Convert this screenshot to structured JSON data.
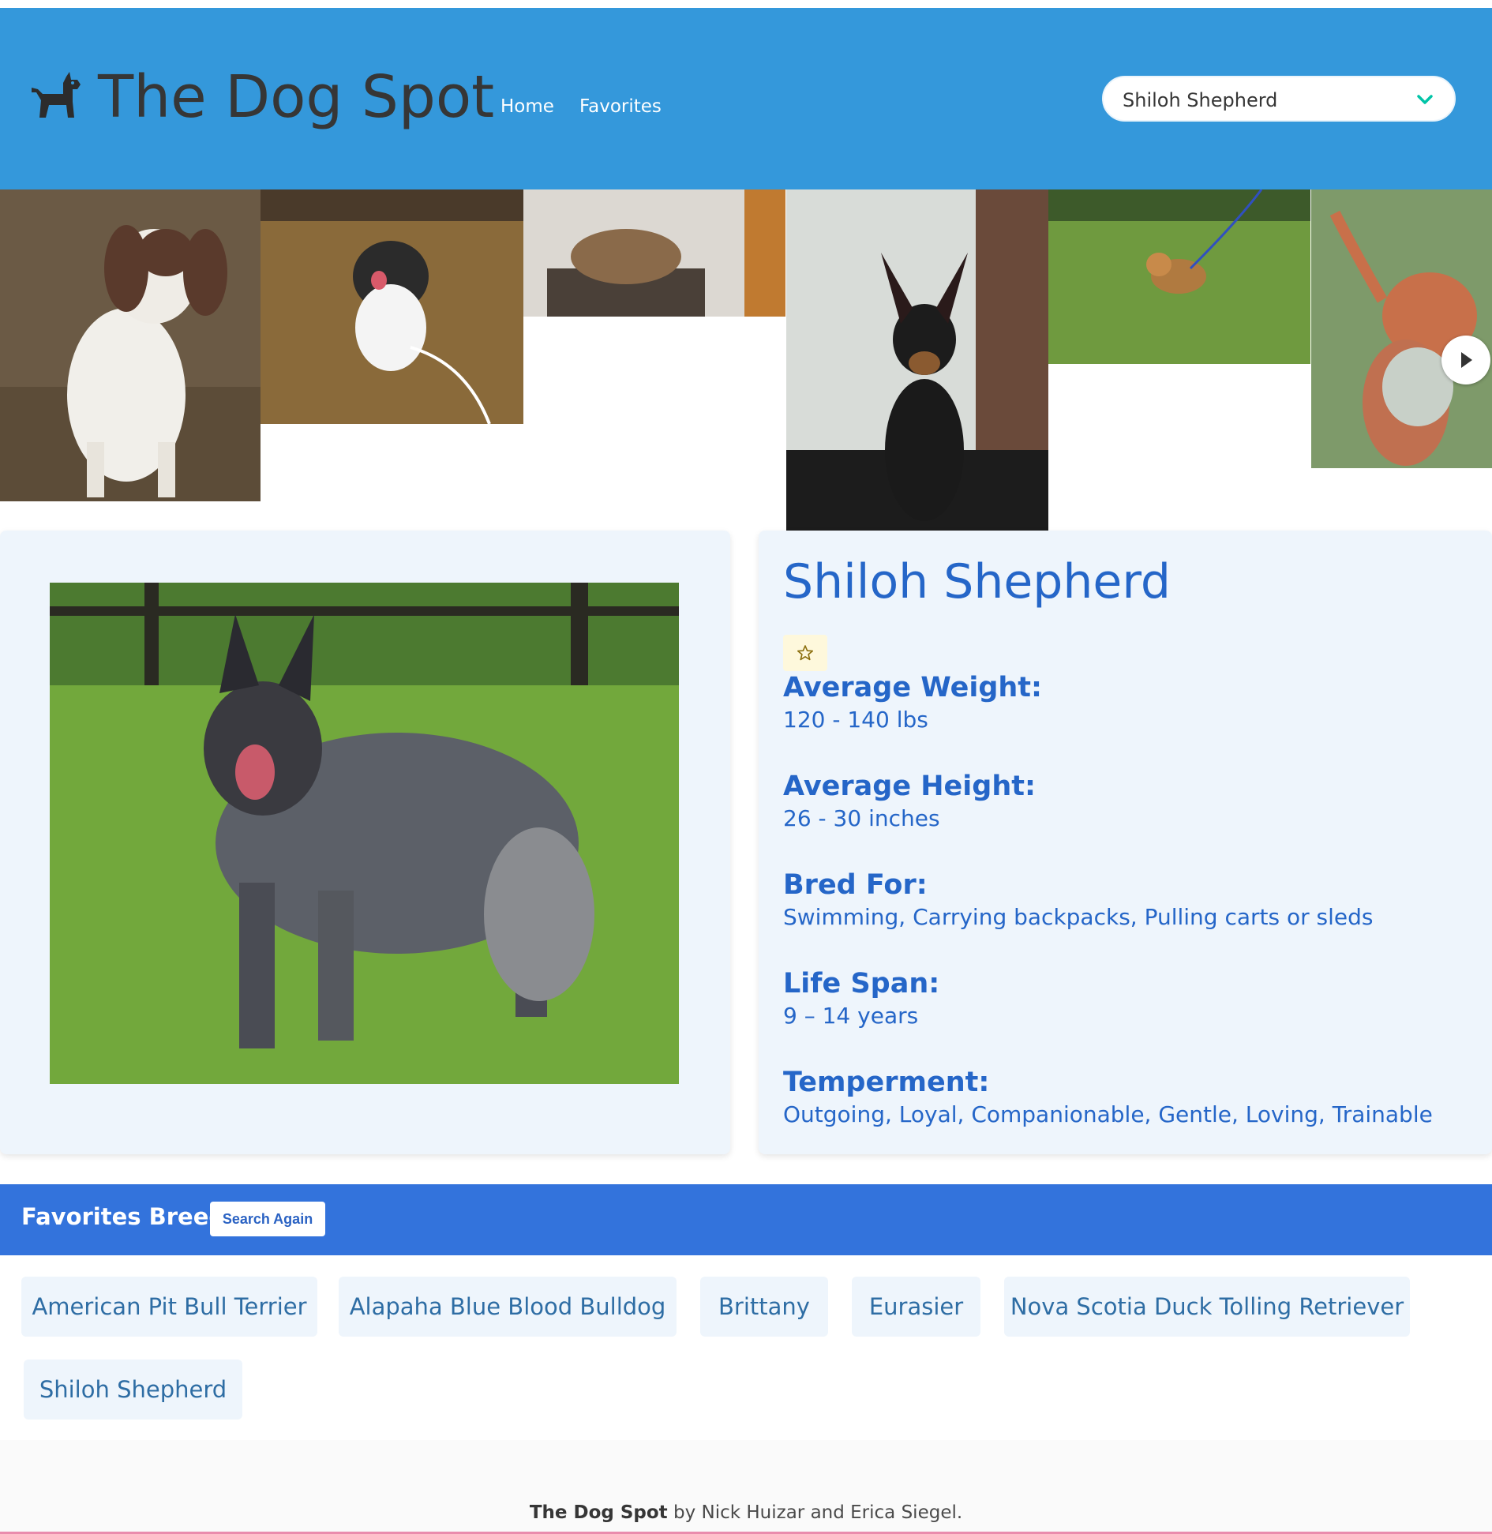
{
  "header": {
    "brand_title": "The Dog Spot",
    "brand_icon": "dog-icon",
    "nav": {
      "home_label": "Home",
      "favorites_label": "Favorites"
    },
    "breed_select": {
      "selected": "Shiloh Shepherd",
      "icon": "chevron-down-icon"
    }
  },
  "carousel": {
    "slides": [
      "dog-photo-1",
      "dog-photo-2",
      "dog-photo-3",
      "dog-photo-4",
      "dog-photo-5",
      "dog-photo-6"
    ],
    "next_icon": "play-right-icon"
  },
  "breed": {
    "name": "Shiloh Shepherd",
    "favorite_icon": "star-outline-icon",
    "details": [
      {
        "label": "Average Weight:",
        "value": "120 - 140 lbs"
      },
      {
        "label": "Average Height:",
        "value": "26 - 30 inches"
      },
      {
        "label": "Bred For:",
        "value": "Swimming, Carrying backpacks, Pulling carts or sleds"
      },
      {
        "label": "Life Span:",
        "value": "9 – 14 years"
      },
      {
        "label": "Temperment:",
        "value": "Outgoing, Loyal, Companionable, Gentle, Loving, Trainable"
      }
    ]
  },
  "favorites": {
    "title": "Favorites Breeds",
    "search_again_label": "Search Again",
    "breeds": [
      "American Pit Bull Terrier",
      "Alapaha Blue Blood Bulldog",
      "Brittany",
      "Eurasier",
      "Nova Scotia Duck Tolling Retriever",
      "Shiloh Shepherd"
    ]
  },
  "footer": {
    "site_name": "The Dog Spot",
    "credit": " by Nick Huizar and Erica Siegel."
  },
  "colors": {
    "navbar": "#3498db",
    "favorites_bar": "#3373dc",
    "accent_text": "#2566c8",
    "card_bg": "#eef5fc"
  }
}
